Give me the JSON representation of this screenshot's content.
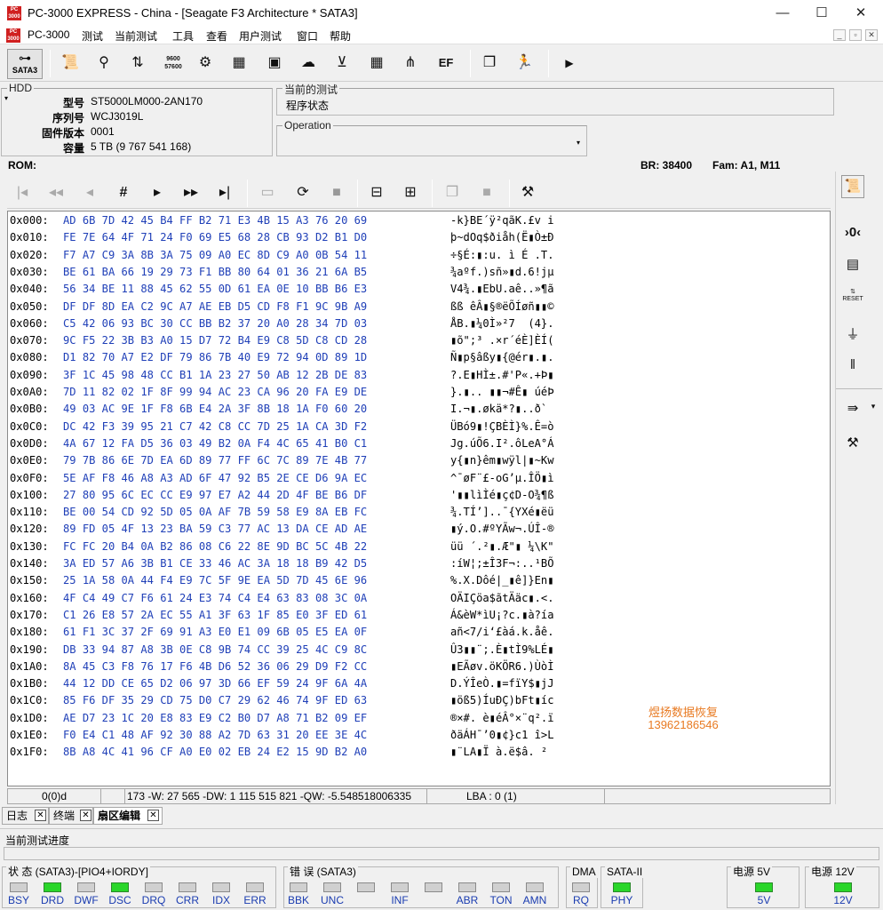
{
  "window": {
    "title": "PC-3000 EXPRESS - China - [Seagate F3 Architecture * SATA3]",
    "min": "—",
    "max": "☐",
    "close": "✕",
    "icon_text": "PC 3000"
  },
  "menu": {
    "items": [
      "PC-3000",
      "测试",
      "当前测试",
      "工具",
      "查看",
      "用户测试",
      "窗口",
      "帮助"
    ],
    "mdi": [
      "_",
      "▫",
      "✕"
    ]
  },
  "toolbar": {
    "sata3_label": "SATA3",
    "icons": [
      "scroll-icon",
      "search-icon",
      "transfer-icon",
      "baud-icon",
      "gear-puzzle-icon",
      "chip-icon",
      "board-icon",
      "cloud-transfer-icon",
      "split-icon",
      "grid-icon",
      "network-icon",
      "ef-icon",
      "copy-icon",
      "runner-icon",
      "play-icon"
    ]
  },
  "hdd": {
    "legend": "HDD",
    "rows": [
      {
        "label": "型号",
        "value": "ST5000LM000-2AN170"
      },
      {
        "label": "序列号",
        "value": "WCJ3019L"
      },
      {
        "label": "固件版本",
        "value": "0001"
      },
      {
        "label": "容量",
        "value": "5 TB (9 767 541 168)"
      }
    ]
  },
  "current_test": {
    "legend": "当前的测试",
    "status": "程序状态"
  },
  "operation": {
    "legend": "Operation",
    "value": ""
  },
  "infobar": {
    "rom": "ROM:",
    "br": "BR: 38400",
    "fam": "Fam: A1, M11"
  },
  "hex": {
    "rows": [
      {
        "off": "0x000:",
        "hex": "AD 6B 7D 42 45 B4 FF B2 71 E3 4B 15 A3 76 20 69",
        "asc": "-k}BE´ÿ²qãK.£v i"
      },
      {
        "off": "0x010:",
        "hex": "FE 7E 64 4F 71 24 F0 69 E5 68 28 CB 93 D2 B1 D0",
        "asc": "þ~dOq$ðiåh(Ë▮Ò±Ð"
      },
      {
        "off": "0x020:",
        "hex": "F7 A7 C9 3A 8B 3A 75 09 A0 EC 8D C9 A0 0B 54 11",
        "asc": "÷§É:▮:u. ì É .T."
      },
      {
        "off": "0x030:",
        "hex": "BE 61 BA 66 19 29 73 F1 BB 80 64 01 36 21 6A B5",
        "asc": "¾aºf.)sñ»▮d.6!jµ"
      },
      {
        "off": "0x040:",
        "hex": "56 34 BE 11 88 45 62 55 0D 61 EA 0E 10 BB B6 E3",
        "asc": "V4¾.▮EbU.aê..»¶ã"
      },
      {
        "off": "0x050:",
        "hex": "DF DF 8D EA C2 9C A7 AE EB D5 CD F8 F1 9C 9B A9",
        "asc": "ßß êÂ▮§®ëÕÍøñ▮▮©"
      },
      {
        "off": "0x060:",
        "hex": "C5 42 06 93 BC 30 CC BB B2 37 20 A0 28 34 7D 03",
        "asc": "ÅB.▮¼0Ì»²7  (4}."
      },
      {
        "off": "0x070:",
        "hex": "9C F5 22 3B B3 A0 15 D7 72 B4 E9 C8 5D C8 CD 28",
        "asc": "▮õ\";³ .×r´éÈ]ÈÍ("
      },
      {
        "off": "0x080:",
        "hex": "D1 82 70 A7 E2 DF 79 86 7B 40 E9 72 94 0D 89 1D",
        "asc": "Ñ▮p§âßy▮{@ér▮.▮."
      },
      {
        "off": "0x090:",
        "hex": "3F 1C 45 98 48 CC B1 1A 23 27 50 AB 12 2B DE 83",
        "asc": "?.E▮HÌ±.#'P«.+Þ▮"
      },
      {
        "off": "0x0A0:",
        "hex": "7D 11 82 02 1F 8F 99 94 AC 23 CA 96 20 FA E9 DE",
        "asc": "}.▮.. ▮▮¬#Ê▮ úéÞ"
      },
      {
        "off": "0x0B0:",
        "hex": "49 03 AC 9E 1F F8 6B E4 2A 3F 8B 18 1A F0 60 20",
        "asc": "I.¬▮.økä*?▮..ð` "
      },
      {
        "off": "0x0C0:",
        "hex": "DC 42 F3 39 95 21 C7 42 C8 CC 7D 25 1A CA 3D F2",
        "asc": "ÜBó9▮!ÇBÈÌ}%.Ê=ò"
      },
      {
        "off": "0x0D0:",
        "hex": "4A 67 12 FA D5 36 03 49 B2 0A F4 4C 65 41 B0 C1",
        "asc": "Jg.úÕ6.I².ôLeA°Á"
      },
      {
        "off": "0x0E0:",
        "hex": "79 7B 86 6E 7D EA 6D 89 77 FF 6C 7C 89 7E 4B 77",
        "asc": "y{▮n}êm▮wÿl|▮~Kw"
      },
      {
        "off": "0x0F0:",
        "hex": "5E AF F8 46 A8 A3 AD 6F 47 92 B5 2E CE D6 9A EC",
        "asc": "^¯øF¨£-oG’µ.ÎÖ▮ì"
      },
      {
        "off": "0x100:",
        "hex": "27 80 95 6C EC CC E9 97 E7 A2 44 2D 4F BE B6 DF",
        "asc": "'▮▮lìÌé▮ç¢D-O¾¶ß"
      },
      {
        "off": "0x110:",
        "hex": "BE 00 54 CD 92 5D 05 0A AF 7B 59 58 E9 8A EB FC",
        "asc": "¾.TÍ’]..¯{YXé▮ëü"
      },
      {
        "off": "0x120:",
        "hex": "89 FD 05 4F 13 23 BA 59 C3 77 AC 13 DA CE AD AE",
        "asc": "▮ý.O.#ºYÃw¬.ÚÎ-®"
      },
      {
        "off": "0x130:",
        "hex": "FC FC 20 B4 0A B2 86 08 C6 22 8E 9D BC 5C 4B 22",
        "asc": "üü ´.²▮.Æ\"▮ ¼\\K\""
      },
      {
        "off": "0x140:",
        "hex": "3A ED 57 A6 3B B1 CE 33 46 AC 3A 18 18 B9 42 D5",
        "asc": ":íW¦;±Î3F¬:..¹BÕ"
      },
      {
        "off": "0x150:",
        "hex": "25 1A 58 0A 44 F4 E9 7C 5F 9E EA 5D 7D 45 6E 96",
        "asc": "%.X.Dôé|_▮ê]}En▮"
      },
      {
        "off": "0x160:",
        "hex": "4F C4 49 C7 F6 61 24 E3 74 C4 E4 63 83 08 3C 0A",
        "asc": "OÄIÇöa$ãtÄäc▮.<."
      },
      {
        "off": "0x170:",
        "hex": "C1 26 E8 57 2A EC 55 A1 3F 63 1F 85 E0 3F ED 61",
        "asc": "Á&èW*ìU¡?c.▮à?ía"
      },
      {
        "off": "0x180:",
        "hex": "61 F1 3C 37 2F 69 91 A3 E0 E1 09 6B 05 E5 EA 0F",
        "asc": "añ<7/i‘£àá.k.åê."
      },
      {
        "off": "0x190:",
        "hex": "DB 33 94 87 A8 3B 0E C8 9B 74 CC 39 25 4C C9 8C",
        "asc": "Û3▮▮¨;.È▮tÌ9%LÉ▮"
      },
      {
        "off": "0x1A0:",
        "hex": "8A 45 C3 F8 76 17 F6 4B D6 52 36 06 29 D9 F2 CC",
        "asc": "▮EÃøv.öKÖR6.)ÙòÌ"
      },
      {
        "off": "0x1B0:",
        "hex": "44 12 DD CE 65 D2 06 97 3D 66 EF 59 24 9F 6A 4A",
        "asc": "D.ÝÎeÒ.▮=fïY$▮jJ"
      },
      {
        "off": "0x1C0:",
        "hex": "85 F6 DF 35 29 CD 75 D0 C7 29 62 46 74 9F ED 63",
        "asc": "▮öß5)ÍuÐÇ)bFt▮íc"
      },
      {
        "off": "0x1D0:",
        "hex": "AE D7 23 1C 20 E8 83 E9 C2 B0 D7 A8 71 B2 09 EF",
        "asc": "®×#. è▮éÂ°×¨q².ï"
      },
      {
        "off": "0x1E0:",
        "hex": "F0 E4 C1 48 AF 92 30 88 A2 7D 63 31 20 EE 3E 4C",
        "asc": "ðäÁH¯’0▮¢}c1 î>L"
      },
      {
        "off": "0x1F0:",
        "hex": "8B A8 4C 41 96 CF A0 E0 02 EB 24 E2 15 9D B2 A0",
        "asc": "▮¨LA▮Ï à.ë$â. ² "
      }
    ],
    "watermark_line1": "煜扬数据恢复",
    "watermark_line2": "13962186546"
  },
  "status": {
    "cell1": "0(0)d",
    "cell2": "",
    "cell3": "173 -W: 27 565 -DW: 1 115 515 821 -QW: -5.548518006335",
    "cell4": "LBA : 0 (1)"
  },
  "tabs": [
    {
      "label": "日志",
      "close": "✕"
    },
    {
      "label": "终端",
      "close": "✕"
    },
    {
      "label": "扇区编辑",
      "close": "✕"
    }
  ],
  "progress_label": "当前测试进度",
  "led_groups": [
    {
      "title": "状 态 (SATA3)-[PIO4+IORDY]",
      "leds": [
        {
          "label": "BSY",
          "on": false
        },
        {
          "label": "DRD",
          "on": true
        },
        {
          "label": "DWF",
          "on": false
        },
        {
          "label": "DSC",
          "on": true
        },
        {
          "label": "DRQ",
          "on": false
        },
        {
          "label": "CRR",
          "on": false
        },
        {
          "label": "IDX",
          "on": false
        },
        {
          "label": "ERR",
          "on": false
        }
      ]
    },
    {
      "title": "错 误 (SATA3)",
      "leds": [
        {
          "label": "BBK",
          "on": false
        },
        {
          "label": "UNC",
          "on": false
        },
        {
          "label": "",
          "on": false
        },
        {
          "label": "INF",
          "on": false
        },
        {
          "label": "",
          "on": false
        },
        {
          "label": "ABR",
          "on": false
        },
        {
          "label": "TON",
          "on": false
        },
        {
          "label": "AMN",
          "on": false
        }
      ]
    },
    {
      "title": "DMA",
      "leds": [
        {
          "label": "RQ",
          "on": false
        }
      ]
    },
    {
      "title": "SATA-II",
      "leds": [
        {
          "label": "PHY",
          "on": true
        }
      ]
    },
    {
      "title": "电源 5V",
      "leds": [
        {
          "label": "5V",
          "on": true
        }
      ]
    },
    {
      "title": "电源 12V",
      "leds": [
        {
          "label": "12V",
          "on": true
        }
      ]
    }
  ],
  "colors": {
    "hex_blue": "#2040b8",
    "led_on": "#2ad62a",
    "watermark": "#e87a22"
  }
}
